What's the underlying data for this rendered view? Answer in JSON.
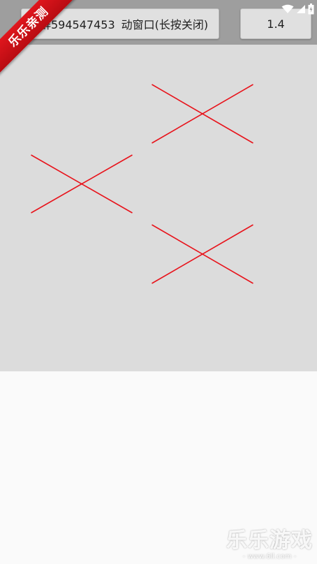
{
  "toolbar": {
    "main_button": {
      "part1": "群594547453",
      "part2": "动窗口(长按关闭)"
    },
    "zoom_button_label": "1.4"
  },
  "status_icons": [
    "wifi-icon",
    "cell-signal-icon",
    "battery-icon"
  ],
  "canvas": {
    "background": "#dcdcdc",
    "marker_color": "#e8141c",
    "marker_count": 3
  },
  "watermarks": {
    "ribbon_text": "乐乐亲测",
    "brand_title": "乐乐游戏",
    "brand_url": "- www.6ll.com -"
  },
  "colors": {
    "toolbar_bg": "#9e9e9e",
    "button_bg": "#e0e0e0",
    "page_bg": "#fafafa",
    "ribbon_red": "#d41016"
  }
}
